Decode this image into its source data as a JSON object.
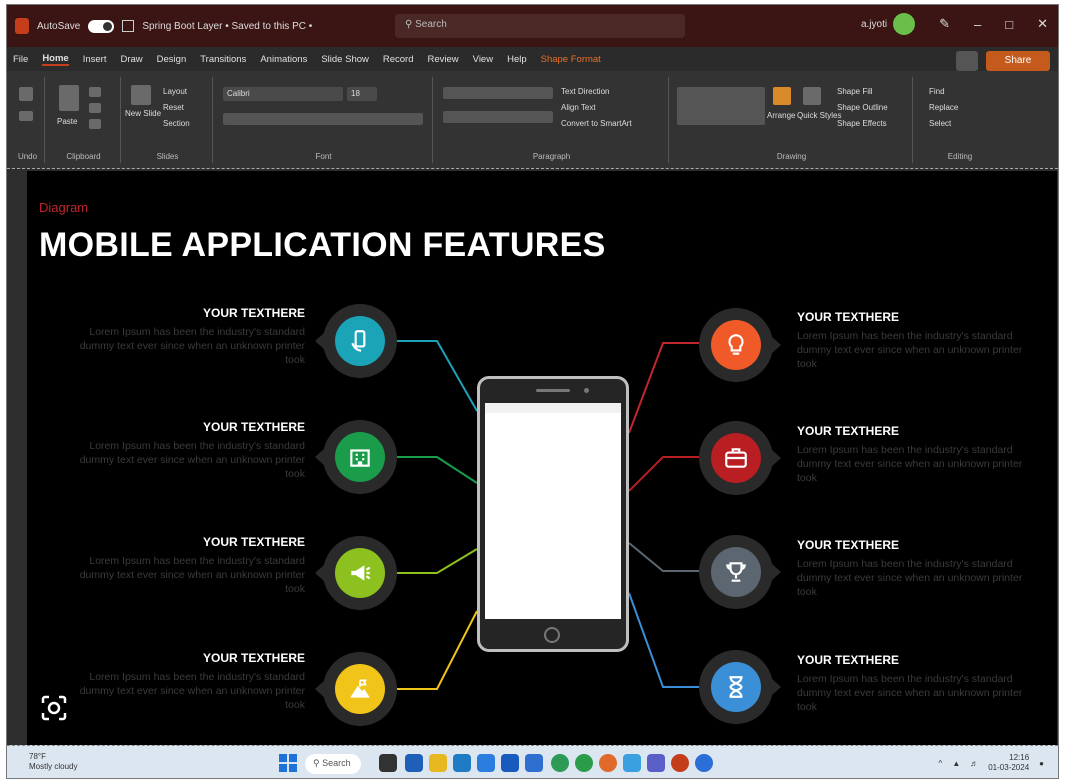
{
  "titlebar": {
    "autosave_label": "AutoSave",
    "toggle_state": "Off",
    "doc_title": "Spring Boot Layer • Saved to this PC •",
    "search_placeholder": "Search",
    "user": "a.jyoti"
  },
  "tabs": [
    "File",
    "Home",
    "Insert",
    "Draw",
    "Design",
    "Transitions",
    "Animations",
    "Slide Show",
    "Record",
    "Review",
    "View",
    "Help",
    "Shape Format"
  ],
  "share_label": "Share",
  "ribbon": {
    "groups": [
      "Undo",
      "Clipboard",
      "Slides",
      "Font",
      "Paragraph",
      "Drawing",
      "Editing"
    ],
    "clipboard": {
      "paste": "Paste"
    },
    "slides": {
      "new_slide": "New Slide",
      "layout": "Layout",
      "reset": "Reset",
      "section": "Section"
    },
    "font": {
      "name": "Calibri",
      "size": "18"
    },
    "paragraph": {
      "text_direction": "Text Direction",
      "align_text": "Align Text",
      "smartart": "Convert to SmartArt"
    },
    "drawing": {
      "arrange": "Arrange",
      "quick_styles": "Quick Styles",
      "shape_fill": "Shape Fill",
      "shape_outline": "Shape Outline",
      "shape_effects": "Shape Effects"
    },
    "editing": {
      "find": "Find",
      "replace": "Replace",
      "select": "Select"
    }
  },
  "slide": {
    "category": "Diagram",
    "title": "MOBILE APPLICATION FEATURES",
    "features_left": [
      {
        "heading": "YOUR TEXTHERE",
        "body": "Lorem Ipsum has been the industry's standard dummy text ever since when an unknown printer took",
        "color": "#1ba3b8",
        "icon": "hand-phone-icon"
      },
      {
        "heading": "YOUR TEXTHERE",
        "body": "Lorem Ipsum has been the industry's standard dummy text ever since when an unknown printer took",
        "color": "#1a9c4b",
        "icon": "building-icon"
      },
      {
        "heading": "YOUR TEXTHERE",
        "body": "Lorem Ipsum has been the industry's standard dummy text ever since when an unknown printer took",
        "color": "#8cc11f",
        "icon": "megaphone-icon"
      },
      {
        "heading": "YOUR TEXTHERE",
        "body": "Lorem Ipsum has been the industry's standard dummy text ever since when an unknown printer took",
        "color": "#f0c419",
        "icon": "mountain-flag-icon"
      }
    ],
    "features_right": [
      {
        "heading": "YOUR TEXTHERE",
        "body": "Lorem Ipsum has been the industry's standard dummy text ever since when an unknown printer took",
        "color": "#f05a28",
        "icon": "lightbulb-icon"
      },
      {
        "heading": "YOUR TEXTHERE",
        "body": "Lorem Ipsum has been the industry's standard dummy text ever since when an unknown printer took",
        "color": "#b81e22",
        "icon": "briefcase-icon"
      },
      {
        "heading": "YOUR TEXTHERE",
        "body": "Lorem Ipsum has been the industry's standard dummy text ever since when an unknown printer took",
        "color": "#5c6670",
        "icon": "trophy-icon"
      },
      {
        "heading": "YOUR TEXTHERE",
        "body": "Lorem Ipsum has been the industry's standard dummy text ever since when an unknown printer took",
        "color": "#3a8fd6",
        "icon": "hourglass-icon"
      }
    ]
  },
  "taskbar": {
    "weather_temp": "78°F",
    "weather_desc": "Mostly cloudy",
    "search_label": "Search",
    "time": "12:16",
    "date": "01-03-2024"
  }
}
